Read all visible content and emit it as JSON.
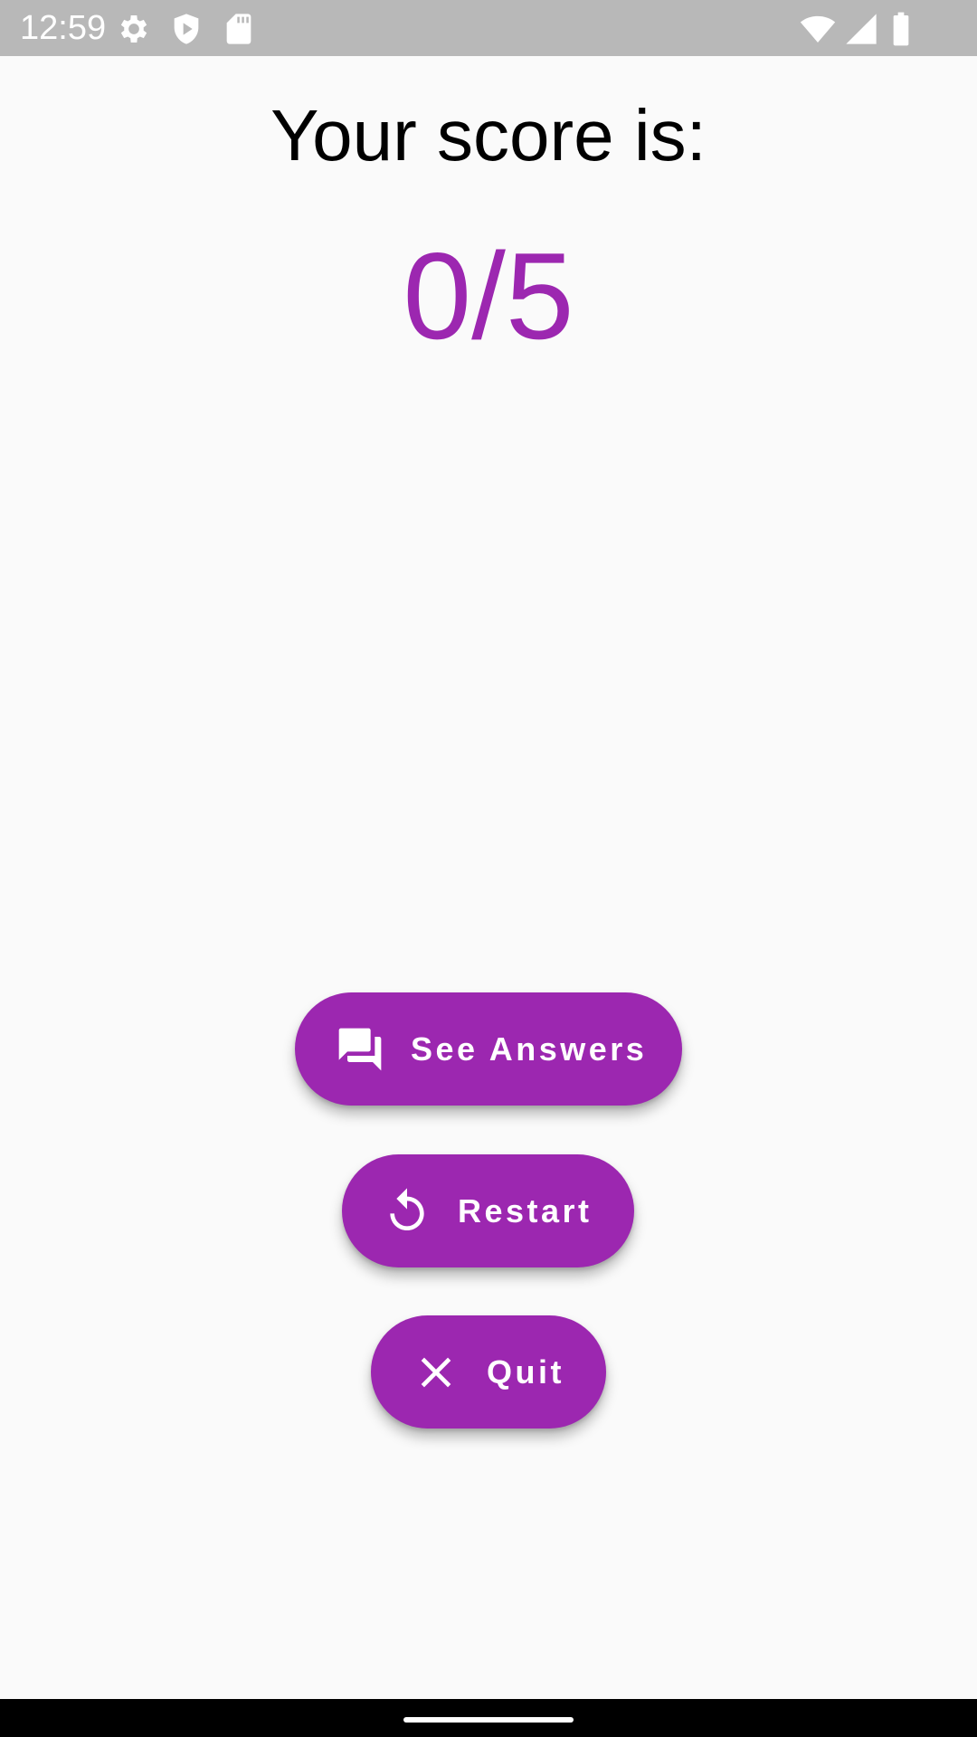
{
  "status_bar": {
    "time": "12:59",
    "left_icons": [
      "gear-icon",
      "shield-play-icon",
      "sd-card-icon"
    ],
    "right_icons": [
      "wifi-icon",
      "cellular-signal-icon",
      "battery-icon"
    ]
  },
  "result": {
    "title": "Your score is:",
    "score": "0/5"
  },
  "actions": {
    "see_answers_label": "See Answers",
    "restart_label": "Restart",
    "quit_label": "Quit"
  },
  "colors": {
    "accent": "#9c27b0",
    "background": "#fafafa",
    "status_bar": "#b8b8b8"
  }
}
